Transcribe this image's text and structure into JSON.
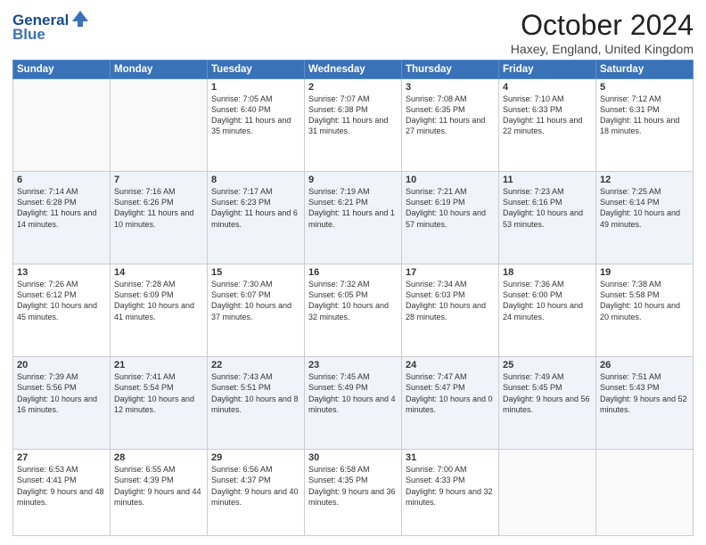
{
  "header": {
    "logo_line1": "General",
    "logo_line2": "Blue",
    "month_title": "October 2024",
    "location": "Haxey, England, United Kingdom"
  },
  "days_of_week": [
    "Sunday",
    "Monday",
    "Tuesday",
    "Wednesday",
    "Thursday",
    "Friday",
    "Saturday"
  ],
  "weeks": [
    [
      {
        "day": "",
        "info": ""
      },
      {
        "day": "",
        "info": ""
      },
      {
        "day": "1",
        "info": "Sunrise: 7:05 AM\nSunset: 6:40 PM\nDaylight: 11 hours and 35 minutes."
      },
      {
        "day": "2",
        "info": "Sunrise: 7:07 AM\nSunset: 6:38 PM\nDaylight: 11 hours and 31 minutes."
      },
      {
        "day": "3",
        "info": "Sunrise: 7:08 AM\nSunset: 6:35 PM\nDaylight: 11 hours and 27 minutes."
      },
      {
        "day": "4",
        "info": "Sunrise: 7:10 AM\nSunset: 6:33 PM\nDaylight: 11 hours and 22 minutes."
      },
      {
        "day": "5",
        "info": "Sunrise: 7:12 AM\nSunset: 6:31 PM\nDaylight: 11 hours and 18 minutes."
      }
    ],
    [
      {
        "day": "6",
        "info": "Sunrise: 7:14 AM\nSunset: 6:28 PM\nDaylight: 11 hours and 14 minutes."
      },
      {
        "day": "7",
        "info": "Sunrise: 7:16 AM\nSunset: 6:26 PM\nDaylight: 11 hours and 10 minutes."
      },
      {
        "day": "8",
        "info": "Sunrise: 7:17 AM\nSunset: 6:23 PM\nDaylight: 11 hours and 6 minutes."
      },
      {
        "day": "9",
        "info": "Sunrise: 7:19 AM\nSunset: 6:21 PM\nDaylight: 11 hours and 1 minute."
      },
      {
        "day": "10",
        "info": "Sunrise: 7:21 AM\nSunset: 6:19 PM\nDaylight: 10 hours and 57 minutes."
      },
      {
        "day": "11",
        "info": "Sunrise: 7:23 AM\nSunset: 6:16 PM\nDaylight: 10 hours and 53 minutes."
      },
      {
        "day": "12",
        "info": "Sunrise: 7:25 AM\nSunset: 6:14 PM\nDaylight: 10 hours and 49 minutes."
      }
    ],
    [
      {
        "day": "13",
        "info": "Sunrise: 7:26 AM\nSunset: 6:12 PM\nDaylight: 10 hours and 45 minutes."
      },
      {
        "day": "14",
        "info": "Sunrise: 7:28 AM\nSunset: 6:09 PM\nDaylight: 10 hours and 41 minutes."
      },
      {
        "day": "15",
        "info": "Sunrise: 7:30 AM\nSunset: 6:07 PM\nDaylight: 10 hours and 37 minutes."
      },
      {
        "day": "16",
        "info": "Sunrise: 7:32 AM\nSunset: 6:05 PM\nDaylight: 10 hours and 32 minutes."
      },
      {
        "day": "17",
        "info": "Sunrise: 7:34 AM\nSunset: 6:03 PM\nDaylight: 10 hours and 28 minutes."
      },
      {
        "day": "18",
        "info": "Sunrise: 7:36 AM\nSunset: 6:00 PM\nDaylight: 10 hours and 24 minutes."
      },
      {
        "day": "19",
        "info": "Sunrise: 7:38 AM\nSunset: 5:58 PM\nDaylight: 10 hours and 20 minutes."
      }
    ],
    [
      {
        "day": "20",
        "info": "Sunrise: 7:39 AM\nSunset: 5:56 PM\nDaylight: 10 hours and 16 minutes."
      },
      {
        "day": "21",
        "info": "Sunrise: 7:41 AM\nSunset: 5:54 PM\nDaylight: 10 hours and 12 minutes."
      },
      {
        "day": "22",
        "info": "Sunrise: 7:43 AM\nSunset: 5:51 PM\nDaylight: 10 hours and 8 minutes."
      },
      {
        "day": "23",
        "info": "Sunrise: 7:45 AM\nSunset: 5:49 PM\nDaylight: 10 hours and 4 minutes."
      },
      {
        "day": "24",
        "info": "Sunrise: 7:47 AM\nSunset: 5:47 PM\nDaylight: 10 hours and 0 minutes."
      },
      {
        "day": "25",
        "info": "Sunrise: 7:49 AM\nSunset: 5:45 PM\nDaylight: 9 hours and 56 minutes."
      },
      {
        "day": "26",
        "info": "Sunrise: 7:51 AM\nSunset: 5:43 PM\nDaylight: 9 hours and 52 minutes."
      }
    ],
    [
      {
        "day": "27",
        "info": "Sunrise: 6:53 AM\nSunset: 4:41 PM\nDaylight: 9 hours and 48 minutes."
      },
      {
        "day": "28",
        "info": "Sunrise: 6:55 AM\nSunset: 4:39 PM\nDaylight: 9 hours and 44 minutes."
      },
      {
        "day": "29",
        "info": "Sunrise: 6:56 AM\nSunset: 4:37 PM\nDaylight: 9 hours and 40 minutes."
      },
      {
        "day": "30",
        "info": "Sunrise: 6:58 AM\nSunset: 4:35 PM\nDaylight: 9 hours and 36 minutes."
      },
      {
        "day": "31",
        "info": "Sunrise: 7:00 AM\nSunset: 4:33 PM\nDaylight: 9 hours and 32 minutes."
      },
      {
        "day": "",
        "info": ""
      },
      {
        "day": "",
        "info": ""
      }
    ]
  ]
}
